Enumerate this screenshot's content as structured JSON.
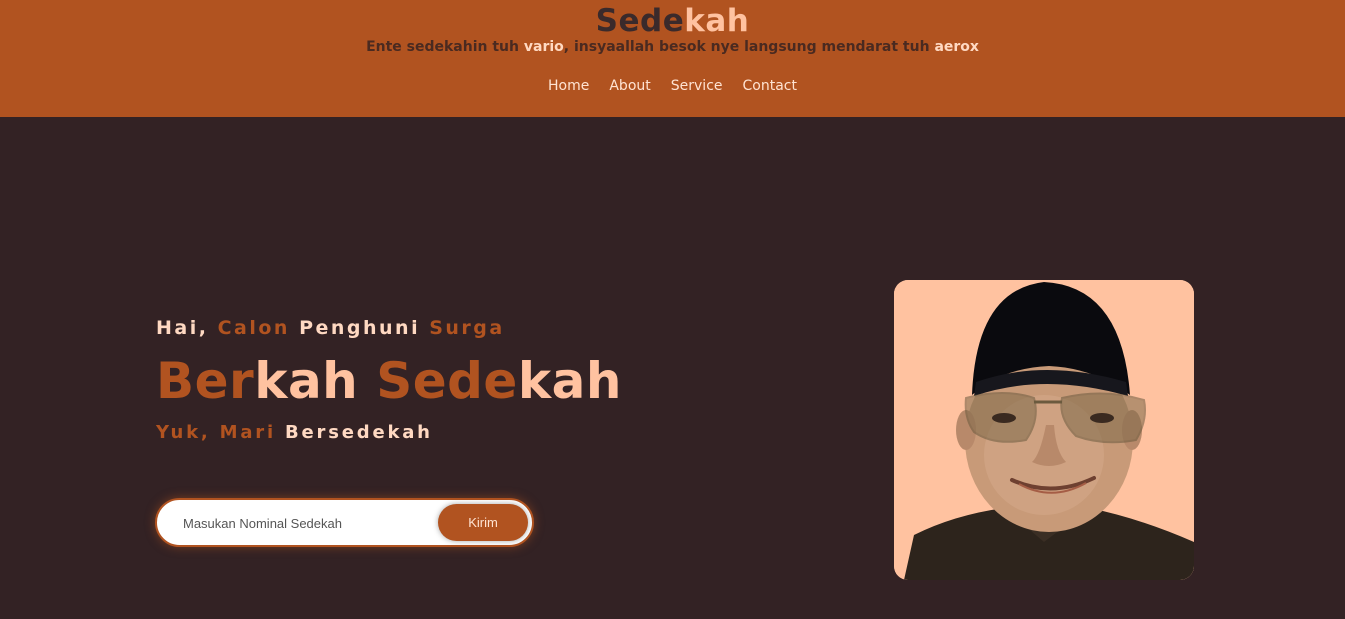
{
  "header": {
    "brand_part1": "Sede",
    "brand_part2": "kah",
    "tagline": {
      "t1": "Ente sedekahin tuh ",
      "h1": "vario",
      "t2": ", insyaallah besok nye langsung mendarat tuh ",
      "h2": "aerox"
    },
    "nav": [
      "Home",
      "About",
      "Service",
      "Contact"
    ]
  },
  "hero": {
    "greeting": [
      "Hai,",
      "Calon",
      "Penghuni",
      "Surga"
    ],
    "title": [
      "Ber",
      "kah",
      "Sede",
      "kah"
    ],
    "subtitle": [
      "Yuk,",
      "Mari",
      "Bersedekah"
    ],
    "form": {
      "placeholder": "Masukan Nominal Sedekah",
      "button_label": "Kirim"
    }
  },
  "colors": {
    "header_bg": "#b15320",
    "page_bg": "#332224",
    "accent": "#b15320",
    "cream": "#ffd9c2",
    "photo_bg": "#ffc2a0"
  }
}
